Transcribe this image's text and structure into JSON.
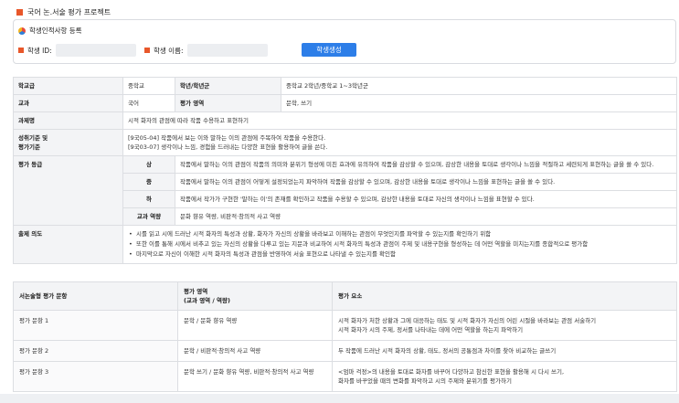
{
  "page_title": "국어 논.서술 평가 프로젝트",
  "register": {
    "title": "학생인적사항 등록",
    "student_id_label": "학생 ID:",
    "student_id_value": "",
    "student_name_label": "학생 이름:",
    "student_name_value": "",
    "generate_button": "학생생성"
  },
  "info": {
    "school_level_label": "학교급",
    "school_level_value": "중학교",
    "grade_label": "학년/학년군",
    "grade_value": "중학교 2학년/중학교 1~3학년군",
    "subject_label": "교과",
    "subject_value": "국어",
    "area_label": "평가 영역",
    "area_value": "문학, 쓰기",
    "task_label": "과제명",
    "task_value": "시적 화자의 관점에 따라 작품 수용하고 표현하기",
    "standards_label_1": "성취기준 및",
    "standards_label_2": "평가기준",
    "standards": [
      "[9국05-04] 작품에서 보는 이와 말하는 이의 관점에 주목하여 작품을 수용한다.",
      "[9국03-07] 생각이나 느낌, 경험을 드러내는 다양한 표현을 활용하여 글을 쓴다."
    ],
    "grade_criteria_label": "평가 등급",
    "levels": [
      {
        "level": "상",
        "desc": "작품에서 말하는 이의 관점이 작품의 의미와 분위기 형성에 미친 효과에 유의하여 작품을 감상할 수 있으며, 감상한 내용을 토대로 생각이나 느낌을 적절하고 세련되게 표현하는 글을 쓸 수 있다."
      },
      {
        "level": "중",
        "desc": "작품에서 말하는 이의 관점이 어떻게 설정되었는지 파악하여 작품을 감상할 수 있으며, 감상한 내용을 토대로 생각이나 느낌을 표현하는 글을 쓸 수 있다."
      },
      {
        "level": "하",
        "desc": "작품에서 작가가 구현한 '말하는 이'의 존재를 확인하고 작품을 수용할 수 있으며, 감상한 내용을 토대로 자신의 생각이나 느낌을 표현할 수 있다."
      }
    ],
    "competency_label": "교과 역량",
    "competency_value": "문화 향유 역량, 비판적·창의적 사고 역량",
    "intent_label": "출제 의도",
    "intents": [
      "시를 읽고 시에 드러난 시적 화자의 특성과 상황, 화자가 자신의 상황을 바라보고 이해하는 관점이 무엇인지를 파악할 수 있는지를 확인하기 위함",
      "또한 이를 통해 시에서 비추고 있는 자신의 상황을 다루고 있는 지문과 비교하여 시적 화자의 특성과 관점이 주제 및 내용구현을 형성하는 데 어떤 역할을 미치는지를 종합적으로 평가함",
      "마지막으로 자신이 이해한 시적 화자의 특성과 관점을 반영하여 서술 표현으로 나타낼 수 있는지를 확인함"
    ]
  },
  "eval_table": {
    "headers": [
      "서논술형 평가 문항",
      "평가 영역\n(교과 영역 / 역량)",
      "평가 요소"
    ],
    "rows": [
      {
        "item": "평가 문항 1",
        "area": "문학 / 문화 향유 역량",
        "elements": [
          "시적 화자가 처한 상황과 그에 대응하는 태도 및 시적 화자가 자신의 어린 시절을 바라보는 관점 서술하기",
          "시적 화자가 시의 주제, 정서를 나타내는 데에 어떤 역할을 하는지 파악하기"
        ]
      },
      {
        "item": "평가 문항 2",
        "area": "문학 / 비판적·창의적 사고 역량",
        "elements": [
          "두 작품에 드러난 시적 화자의 상황, 태도, 정서의 공통점과 차이를 찾아 비교하는 글쓰기"
        ]
      },
      {
        "item": "평가 문항 3",
        "area": "문학 쓰기 / 문화 향유 역량, 비판적·창의적 사고 역량",
        "elements": [
          "<엄마 걱정>의 내용을 토대로 화자를 바꾸어 다양하고 참신한 표현을 활용해 시 다시 쓰기,",
          "화자를 바꾸었을 때의 변화를 파악하고 시의 주제와 분위기를 평가하기"
        ]
      }
    ]
  },
  "colors": {
    "accent": "#e8572a",
    "button": "#2d7ee8",
    "label_bg": "#f3f4f6"
  }
}
